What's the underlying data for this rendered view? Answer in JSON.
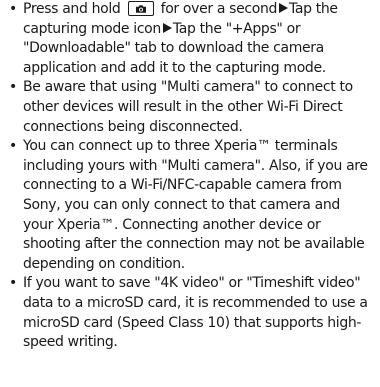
{
  "notes": [
    {
      "bullet": "•",
      "parts": [
        "Press and hold",
        "for over a second",
        "Tap the capturing mode icon",
        "Tap the \"+Apps\" or \"Downloadable\" tab to download the camera application and add it to the capturing mode."
      ]
    },
    {
      "bullet": "•",
      "text": "Be aware that using \"Multi camera\" to connect to other devices will result in the other Wi-Fi Direct connections being disconnected."
    },
    {
      "bullet": "•",
      "text": "You can connect up to three Xperia™ terminals including yours with \"Multi camera\". Also, if you are connecting to a Wi-Fi/NFC-capable camera from Sony, you can only connect to that camera and your Xperia™. Connecting another device or shooting after the connection may not be available depending on condition."
    },
    {
      "bullet": "•",
      "text": "If you want to save \"4K video\" or \"Timeshift video\" data to a microSD card, it is recommended to use a microSD card (Speed Class 10) that supports high-speed writing."
    }
  ],
  "icons": {
    "camera_key": "camera-key-icon",
    "arrow": "right-arrow-icon"
  }
}
